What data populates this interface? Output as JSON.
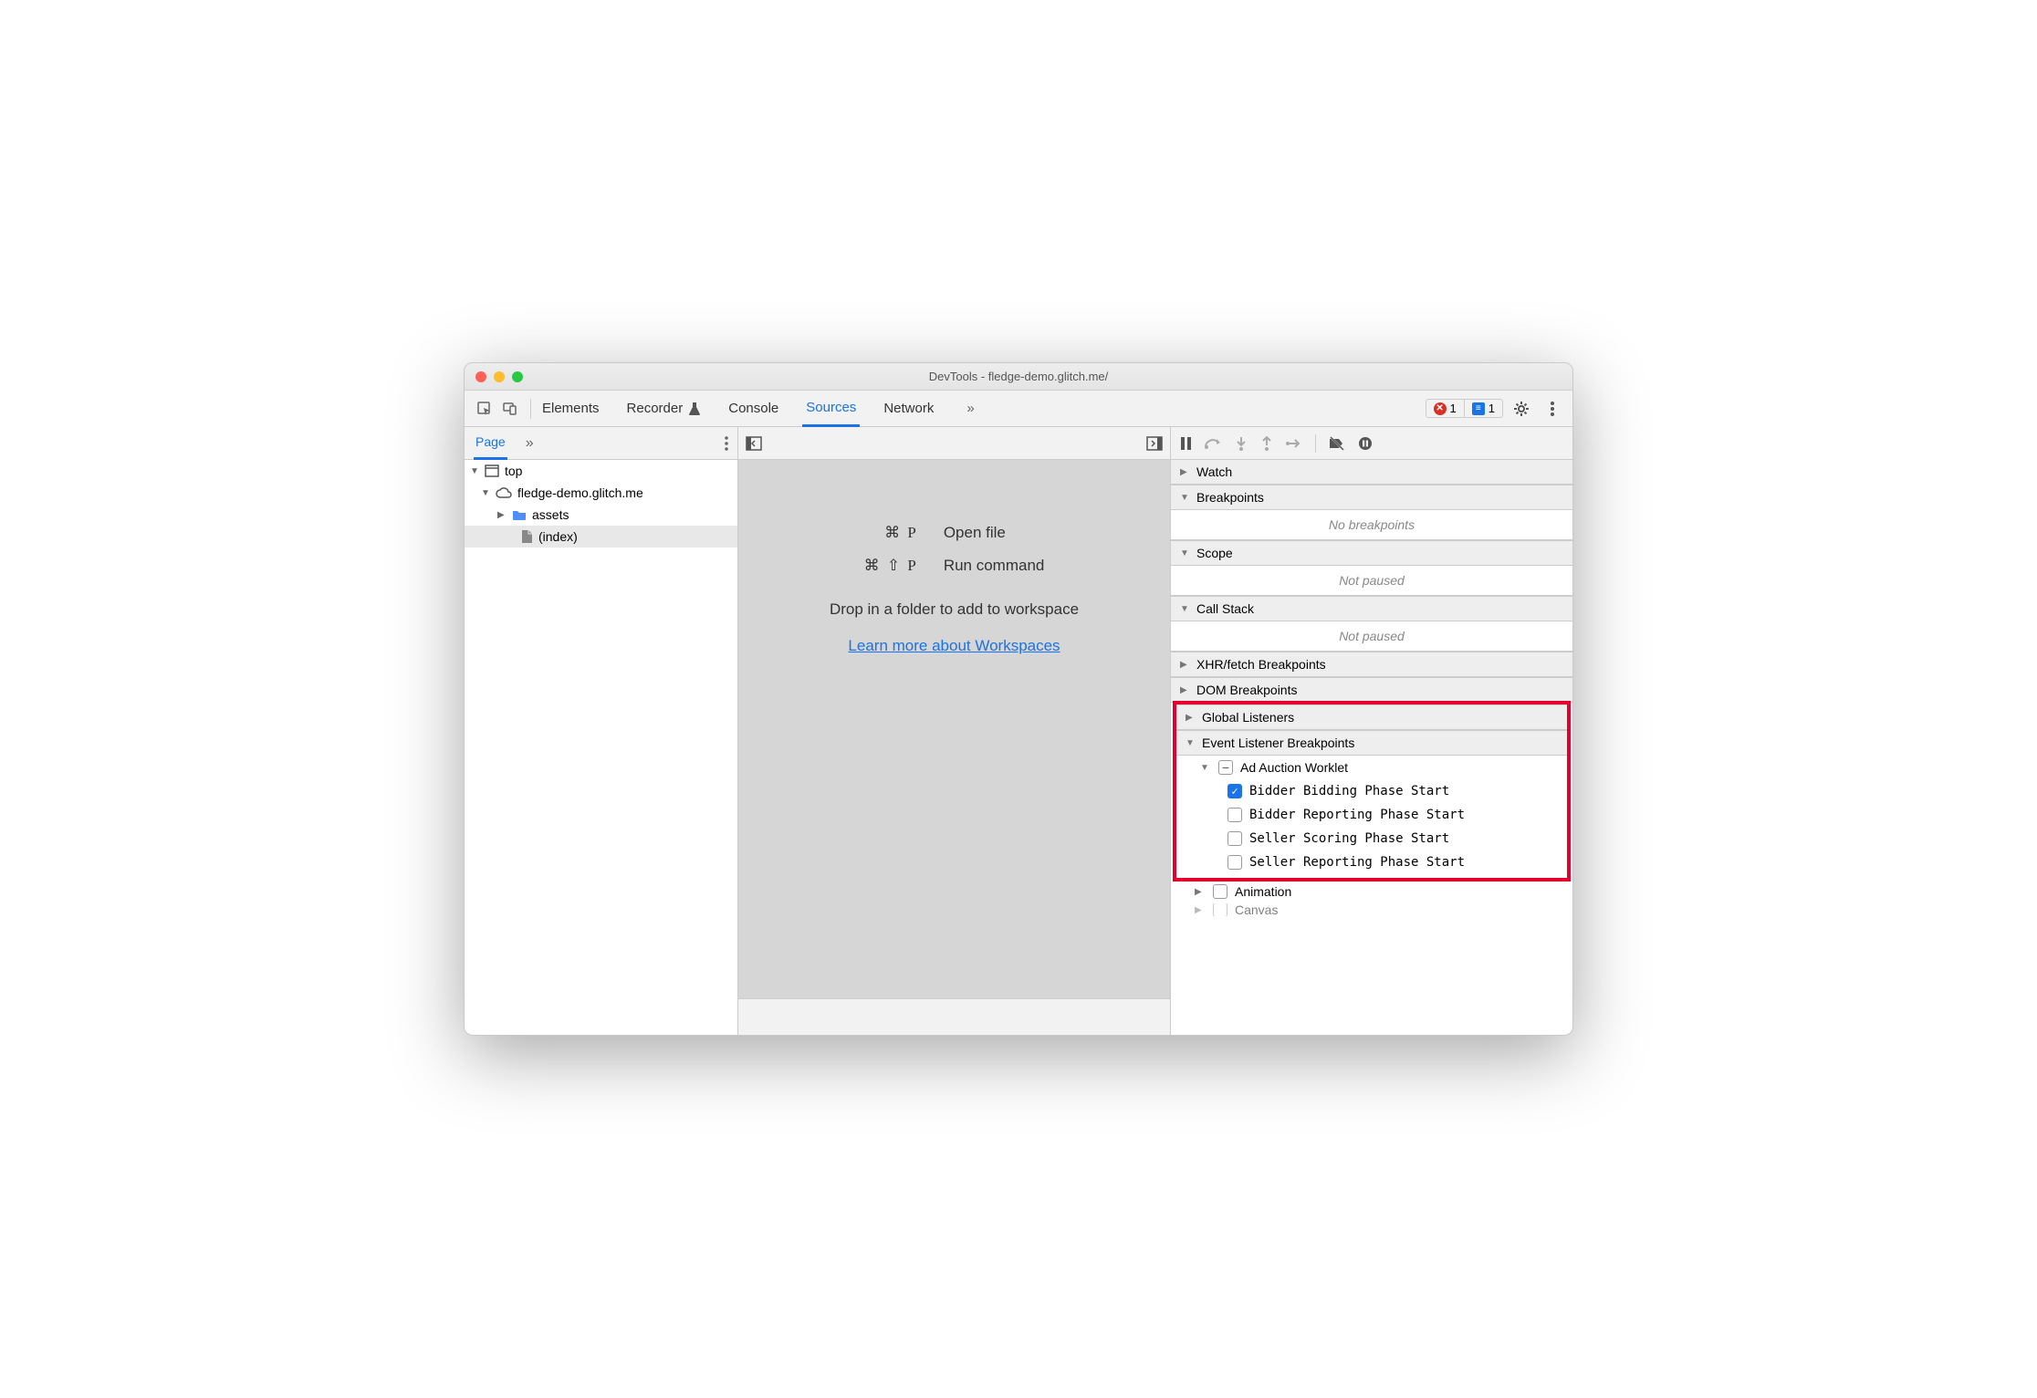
{
  "window": {
    "title": "DevTools - fledge-demo.glitch.me/"
  },
  "tabs": {
    "items": [
      "Elements",
      "Recorder",
      "Console",
      "Sources",
      "Network"
    ],
    "active": "Sources"
  },
  "badges": {
    "errors": "1",
    "messages": "1"
  },
  "page_tab": "Page",
  "tree": {
    "top": "top",
    "origin": "fledge-demo.glitch.me",
    "folder": "assets",
    "file": "(index)"
  },
  "editor": {
    "open_key": "⌘ P",
    "open_label": "Open file",
    "run_key": "⌘ ⇧ P",
    "run_label": "Run command",
    "drop_text": "Drop in a folder to add to workspace",
    "link_text": "Learn more about Workspaces"
  },
  "debug_sections": {
    "watch": "Watch",
    "breakpoints": "Breakpoints",
    "breakpoints_empty": "No breakpoints",
    "scope": "Scope",
    "scope_empty": "Not paused",
    "callstack": "Call Stack",
    "callstack_empty": "Not paused",
    "xhr": "XHR/fetch Breakpoints",
    "dom": "DOM Breakpoints",
    "global": "Global Listeners",
    "event": "Event Listener Breakpoints",
    "ad_auction": "Ad Auction Worklet",
    "events": [
      "Bidder Bidding Phase Start",
      "Bidder Reporting Phase Start",
      "Seller Scoring Phase Start",
      "Seller Reporting Phase Start"
    ],
    "animation": "Animation",
    "canvas": "Canvas"
  }
}
